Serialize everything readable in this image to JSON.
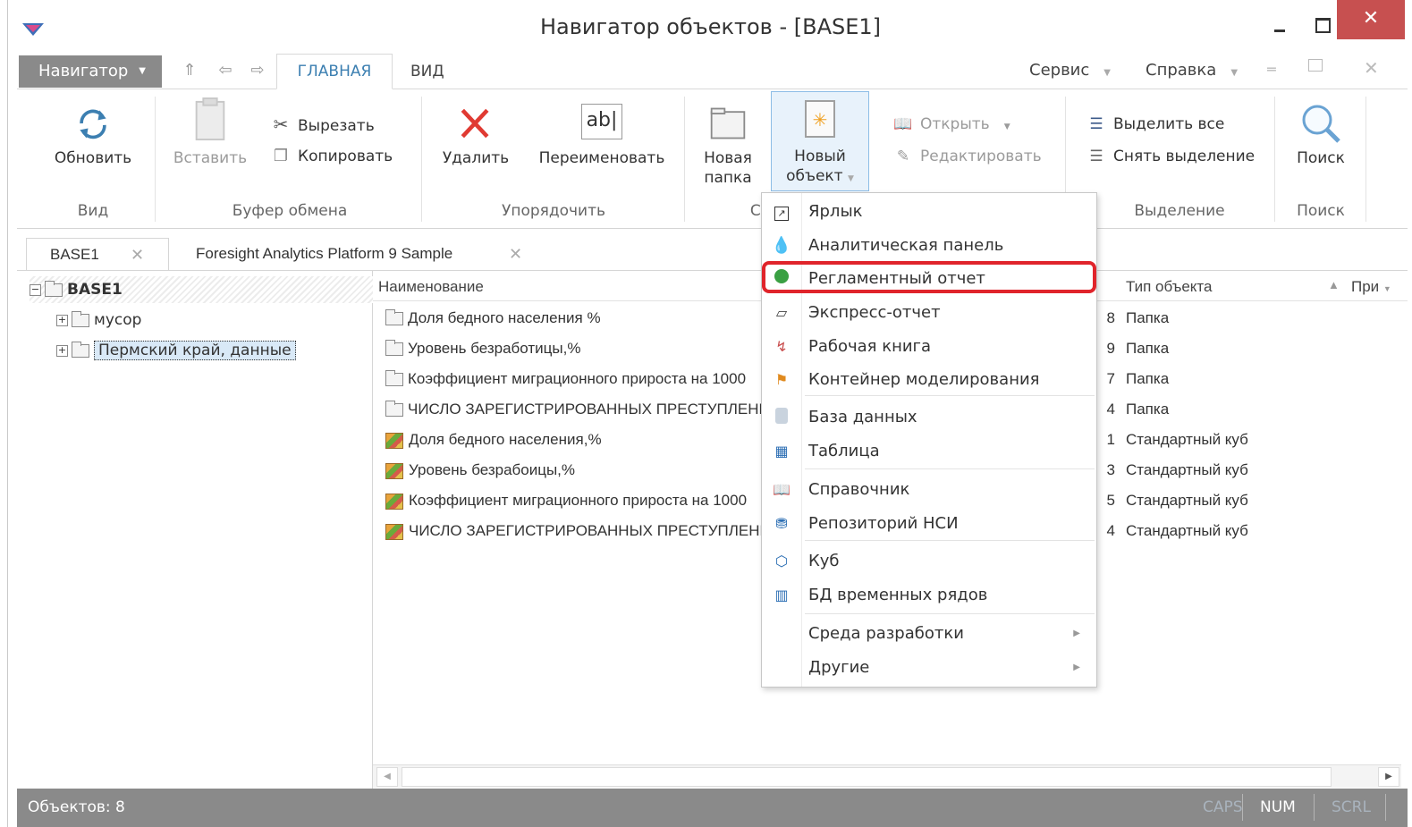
{
  "window": {
    "title": "Навигатор объектов - [BASE1]",
    "close_glyph": "✕"
  },
  "menubar": {
    "navigator_label": "Навигатор",
    "tab_main": "ГЛАВНАЯ",
    "tab_view": "ВИД",
    "service": "Сервис",
    "help": "Справка"
  },
  "ribbon": {
    "refresh": "Обновить",
    "paste": "Вставить",
    "cut": "Вырезать",
    "copy": "Копировать",
    "delete": "Удалить",
    "rename": "Переименовать",
    "rename_icon_text": "ab|",
    "new_folder_line1": "Новая",
    "new_folder_line2": "папка",
    "new_object_line1": "Новый",
    "new_object_line2": "объект",
    "open": "Открыть",
    "edit": "Редактировать",
    "select_all": "Выделить все",
    "clear_selection": "Снять выделение",
    "search": "Поиск",
    "groups": {
      "view": "Вид",
      "clipboard": "Буфер обмена",
      "arrange": "Упорядочить",
      "create_partial": "Со",
      "selection": "Выделение",
      "search": "Поиск"
    }
  },
  "doc_tabs": [
    {
      "label": "BASE1"
    },
    {
      "label": "Foresight Analytics Platform 9 Sample"
    }
  ],
  "tree": {
    "root": "BASE1",
    "children": [
      {
        "label": "мусор"
      },
      {
        "label": "Пермский край, данные"
      }
    ]
  },
  "list": {
    "col_name": "Наименование",
    "col_type": "Тип объекта",
    "col_more": "При",
    "rows": [
      {
        "name": "Доля бедного населения %",
        "date": "8",
        "type": "Папка",
        "kind": "folder"
      },
      {
        "name": "Уровень безработицы,%",
        "date": "9",
        "type": "Папка",
        "kind": "folder"
      },
      {
        "name": "Коэффициент миграционного прироста на 1000",
        "date": "7",
        "type": "Папка",
        "kind": "folder"
      },
      {
        "name": "ЧИСЛО ЗАРЕГИСТРИРОВАННЫХ ПРЕСТУПЛЕНИЙ",
        "date": "4",
        "type": "Папка",
        "kind": "folder"
      },
      {
        "name": "Доля бедного населения,%",
        "date": "1",
        "type": "Стандартный куб",
        "kind": "cube"
      },
      {
        "name": "Уровень безрабоицы,%",
        "date": "3",
        "type": "Стандартный куб",
        "kind": "cube"
      },
      {
        "name": "Коэффициент миграционного прироста на 1000",
        "date": "5",
        "type": "Стандартный куб",
        "kind": "cube"
      },
      {
        "name": "ЧИСЛО ЗАРЕГИСТРИРОВАННЫХ ПРЕСТУПЛЕНИЙ",
        "date": "4",
        "type": "Стандартный куб",
        "kind": "cube"
      }
    ]
  },
  "new_menu": {
    "items": [
      {
        "label": "Ярлык",
        "icon": "shortcut-icon"
      },
      {
        "label": "Аналитическая панель",
        "icon": "dashboard-icon"
      },
      {
        "label": "Регламентный отчет",
        "icon": "regular-report-icon",
        "highlighted": true
      },
      {
        "label": "Экспресс-отчет",
        "icon": "express-report-icon"
      },
      {
        "label": "Рабочая книга",
        "icon": "workbook-icon"
      },
      {
        "label": "Контейнер моделирования",
        "icon": "modeling-container-icon"
      },
      {
        "label": "База данных",
        "icon": "database-icon"
      },
      {
        "label": "Таблица",
        "icon": "table-icon"
      },
      {
        "label": "Справочник",
        "icon": "dictionary-icon"
      },
      {
        "label": "Репозиторий НСИ",
        "icon": "mdm-repository-icon"
      },
      {
        "label": "Куб",
        "icon": "cube-icon"
      },
      {
        "label": "БД временных рядов",
        "icon": "time-series-db-icon"
      },
      {
        "label": "Среда разработки",
        "icon": "",
        "submenu": true
      },
      {
        "label": "Другие",
        "icon": "",
        "submenu": true
      }
    ]
  },
  "status": {
    "count": "Объектов: 8",
    "caps": "CAPS",
    "num": "NUM",
    "scrl": "SCRL"
  },
  "colors": {
    "accent": "#3c7fb1",
    "highlight": "#e0242b",
    "statusbar": "#8a8a8a",
    "close_button": "#c75050"
  }
}
